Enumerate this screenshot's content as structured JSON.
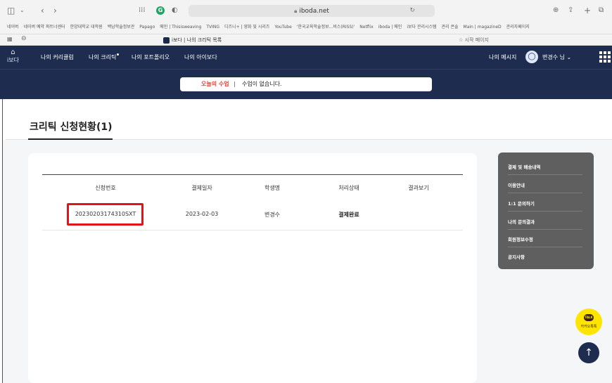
{
  "browser": {
    "url": "iboda.net",
    "bookmarks": [
      "네이버",
      "네이버 예약 파트너센터",
      "한양대학교 대학원",
      "백남학술정보관",
      "Papago",
      "메인 | Thisisweaving",
      "TVING",
      "디즈니+ | 영화 및 시리즈",
      "YouTube",
      "'한국교육학술정보...비스(RISS)'",
      "Netflix",
      "iboda | 메인",
      "i보다 관리시스템",
      "관리 콘솔",
      "Main | magazineD",
      "관리자페이지"
    ],
    "tab_title": "i보다 | 나의 크리틱 목록",
    "tab_start": "시작 페이지"
  },
  "nav": {
    "logo": "i보다",
    "items": [
      "나의 커리큘럼",
      "나의 크리틱",
      "나의 포트폴리오",
      "나의 아이보다"
    ],
    "messages": "나의 메시지",
    "user": "변경수 님"
  },
  "today": {
    "label": "오늘의 수업",
    "separator": "|",
    "message": "수업이 없습니다."
  },
  "page": {
    "title": "크리틱 신청현황(1)"
  },
  "table": {
    "headers": [
      "신청번호",
      "결제일자",
      "학생명",
      "처리상태",
      "결과보기"
    ],
    "rows": [
      [
        "20230203174310SXT",
        "2023-02-03",
        "변경수",
        "결제완료",
        ""
      ]
    ]
  },
  "sidemenu": {
    "items": [
      "결제 및 배송내역",
      "이용안내",
      "1:1 문의하기",
      "나의 문의결과",
      "회원정보수정",
      "공지사항"
    ]
  },
  "floating": {
    "kakao_badge": "TALK",
    "kakao_label": "카카오톡톡",
    "top_arrow": "↑"
  },
  "colors": {
    "navy": "#1e2d4f",
    "highlight_red": "#e2141b",
    "today_red": "#e04a3a",
    "kakao_yellow": "#fee500",
    "sidemenu_gray": "#5f5f60"
  }
}
